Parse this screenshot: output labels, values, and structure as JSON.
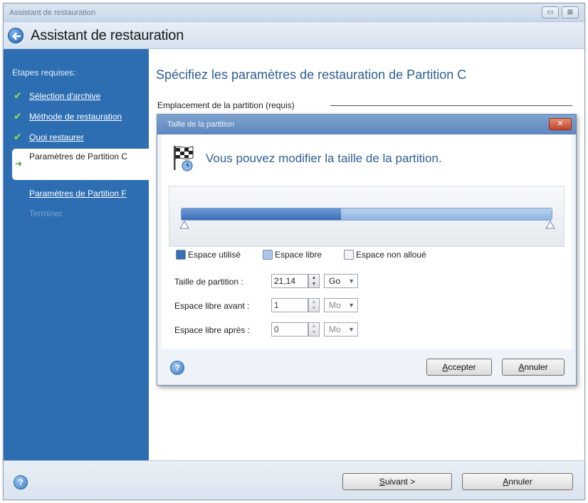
{
  "window": {
    "title": "Assistant de restauration",
    "controls": [
      "▭",
      "⊠"
    ]
  },
  "header": {
    "title": "Assistant de restauration"
  },
  "sidebar": {
    "heading": "Etapes requises:",
    "completed_steps": [
      {
        "label": "Sélection d'archive"
      },
      {
        "label": "Méthode de restauration"
      },
      {
        "label": "Quoi restaurer"
      }
    ],
    "active_step": "Paramètres de Partition C",
    "next_step": "Paramètres de Partition F",
    "disabled_step": "Terminer"
  },
  "main": {
    "title": "Spécifiez les paramètres de restauration de Partition C",
    "section_label": "Emplacement de la partition (requis)"
  },
  "dialog": {
    "title": "Taille de la partition",
    "close_label": "✕",
    "heading": "Vous pouvez modifier la taille de la partition.",
    "bar": {
      "used_fraction": 0.43,
      "free_fraction": 0.57
    },
    "legend": {
      "used": "Espace utilisé",
      "free": "Espace libre",
      "unallocated": "Espace non alloué"
    },
    "fields": {
      "size": {
        "label": "Taille de partition :",
        "value": "21,14",
        "unit": "Go"
      },
      "before": {
        "label": "Espace libre avant :",
        "value": "1",
        "unit": "Mo"
      },
      "after": {
        "label": "Espace libre après :",
        "value": "0",
        "unit": "Mo"
      }
    },
    "accept_label": "ccepter",
    "accept_mnemonic": "A",
    "cancel_label": "nnuler",
    "cancel_mnemonic": "A"
  },
  "footer": {
    "next_label": "uivant >",
    "next_mnemonic": "S",
    "cancel_label": "nnuler",
    "cancel_mnemonic": "A"
  },
  "colors": {
    "sidebar": "#2d6eb3",
    "accent_text": "#2e5f95",
    "used_space": "#3a6fb7",
    "free_space": "#8eb4e0"
  }
}
